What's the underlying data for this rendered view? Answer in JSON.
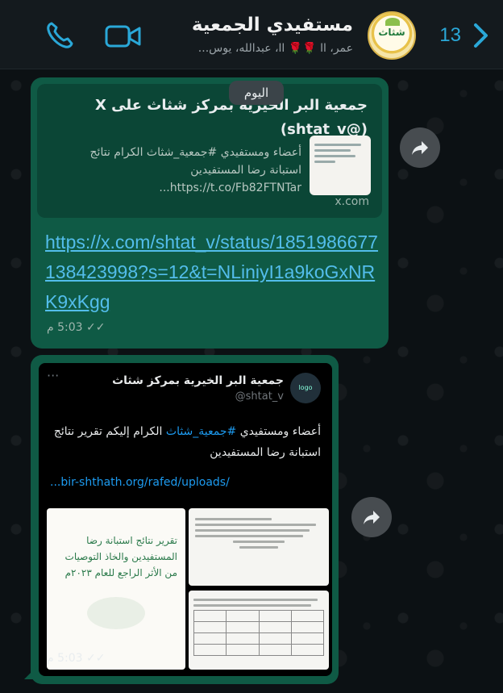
{
  "header": {
    "back_count": "13",
    "title": "مستفيدي الجمعية",
    "subtitle": "عمر، اا 🌹🌹 اا، عبدالله، يوس...",
    "avatar_text": "شثاث"
  },
  "chat": {
    "date_pill": "اليوم",
    "message1": {
      "preview_title": "جمعية البر الخيرية بمركز شثاث على X (shtat_v@)",
      "preview_description": "أعضاء ومستفيدي #جمعية_شثاث الكرام نتائج استبانة رضا المستفيدين https://t.co/Fb82FTNTar...",
      "preview_domain": "x.com",
      "link_text": "https://x.com/shtat_v/status/1851986677138423998?s=12&t=NLiniyI1a9koGxNRK9xKgg",
      "time": "5:03 م"
    },
    "message2": {
      "tweet_name": "جمعية البر الخيرية بمركز شثاث",
      "tweet_handle": "@shtat_v",
      "tweet_body_prefix": "أعضاء ومستفيدي ",
      "tweet_hashtag": "#جمعية_شثاث",
      "tweet_body_suffix": " الكرام إليكم تقرير نتائج استبانة رضا المستفيدين",
      "tweet_url": "...bir-shthath.org/rafed/uploads/",
      "image1_title": "تقرير نتائج استبانة رضا المستفيدين والخاذ التوصيات من الأثر الراجع للعام ٢٠٢٣م",
      "time": "5:03 م"
    }
  },
  "colors": {
    "bubble": "#0f5a45",
    "link": "#53bdeb",
    "accent": "#2aa8d8"
  }
}
